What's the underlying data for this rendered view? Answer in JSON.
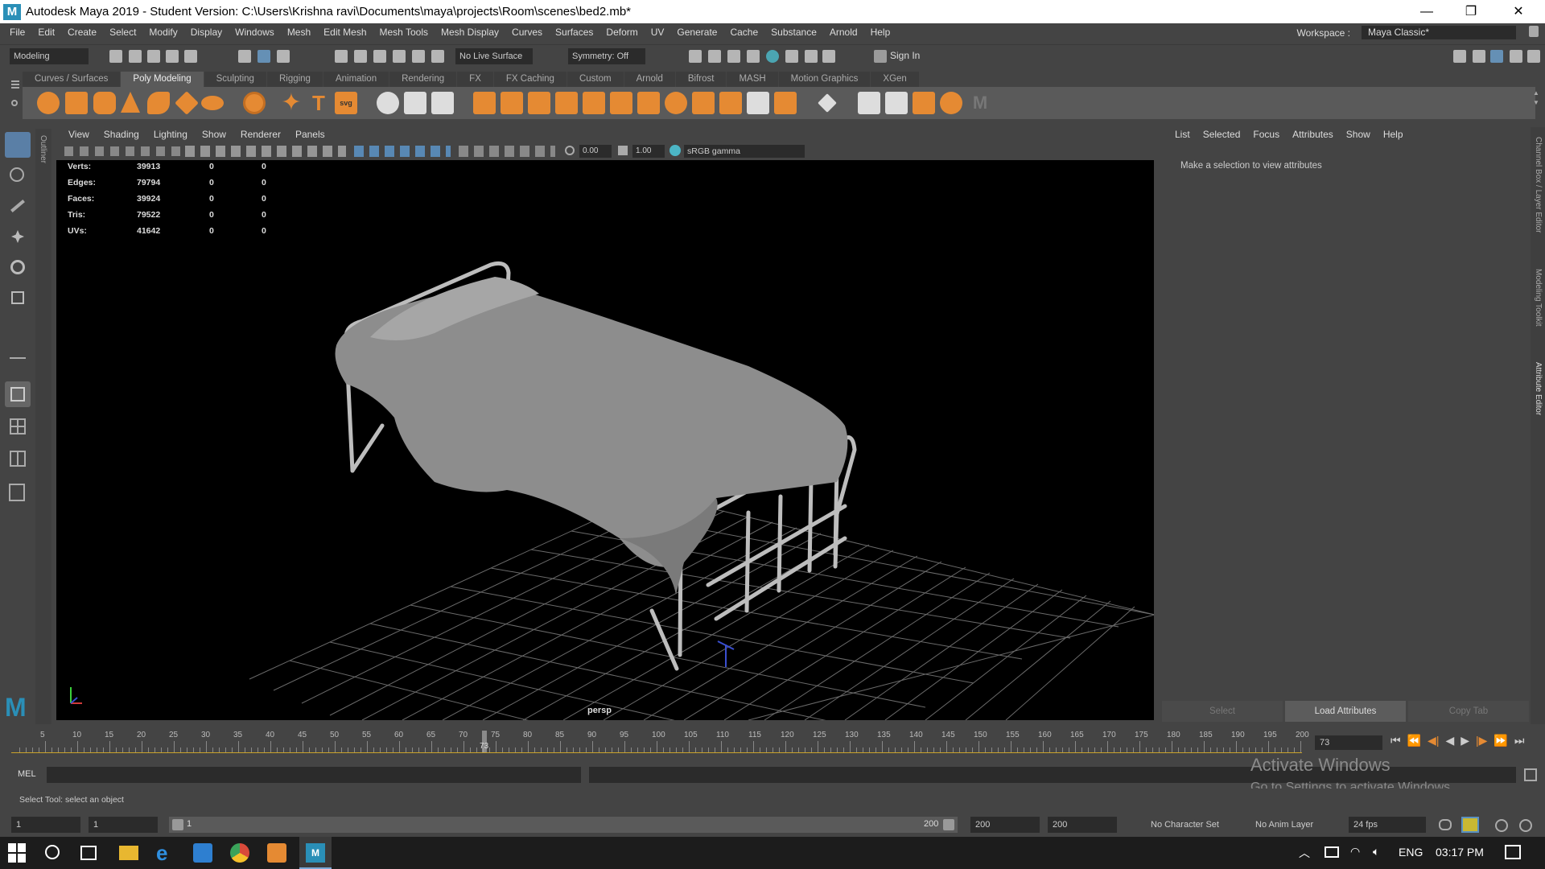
{
  "title_bar": {
    "app_title": "Autodesk Maya 2019 - Student Version: C:\\Users\\Krishna ravi\\Documents\\maya\\projects\\Room\\scenes\\bed2.mb*",
    "logo_letter": "M"
  },
  "menu": [
    "File",
    "Edit",
    "Create",
    "Select",
    "Modify",
    "Display",
    "Windows",
    "Mesh",
    "Edit Mesh",
    "Mesh Tools",
    "Mesh Display",
    "Curves",
    "Surfaces",
    "Deform",
    "UV",
    "Generate",
    "Cache",
    "Substance",
    "Arnold",
    "Help"
  ],
  "workspace": {
    "label": "Workspace :",
    "value": "Maya Classic*"
  },
  "status_line": {
    "mode": "Modeling",
    "live_surface": "No Live Surface",
    "symmetry": "Symmetry: Off",
    "sign_in": "Sign In"
  },
  "shelf_tabs": [
    "Curves / Surfaces",
    "Poly Modeling",
    "Sculpting",
    "Rigging",
    "Animation",
    "Rendering",
    "FX",
    "FX Caching",
    "Custom",
    "Arnold",
    "Bifrost",
    "MASH",
    "Motion Graphics",
    "XGen"
  ],
  "shelf_active": "Poly Modeling",
  "outliner_label": "Outliner",
  "viewport_menu": [
    "View",
    "Shading",
    "Lighting",
    "Show",
    "Renderer",
    "Panels"
  ],
  "viewport_toolbar": {
    "exposure": "0.00",
    "gamma": "1.00",
    "color_space": "sRGB gamma"
  },
  "hud": {
    "rows": [
      {
        "label": "Verts:",
        "v1": "39913",
        "v2": "0",
        "v3": "0"
      },
      {
        "label": "Edges:",
        "v1": "79794",
        "v2": "0",
        "v3": "0"
      },
      {
        "label": "Faces:",
        "v1": "39924",
        "v2": "0",
        "v3": "0"
      },
      {
        "label": "Tris:",
        "v1": "79522",
        "v2": "0",
        "v3": "0"
      },
      {
        "label": "UVs:",
        "v1": "41642",
        "v2": "0",
        "v3": "0"
      }
    ],
    "camera": "persp"
  },
  "attribute_editor": {
    "menu": [
      "List",
      "Selected",
      "Focus",
      "Attributes",
      "Show",
      "Help"
    ],
    "message": "Make a selection to view attributes",
    "buttons": {
      "select": "Select",
      "load": "Load Attributes",
      "copy": "Copy Tab"
    }
  },
  "right_strip": {
    "channel_box": "Channel Box / Layer Editor",
    "modeling_toolkit": "Modeling Toolkit",
    "attribute_editor": "Attribute Editor"
  },
  "timeline": {
    "ticks": [
      "5",
      "10",
      "15",
      "20",
      "25",
      "30",
      "35",
      "40",
      "45",
      "50",
      "55",
      "60",
      "65",
      "70",
      "75",
      "80",
      "85",
      "90",
      "95",
      "100",
      "105",
      "110",
      "115",
      "120",
      "125",
      "130",
      "135",
      "140",
      "145",
      "150",
      "155",
      "160",
      "165",
      "170",
      "175",
      "180",
      "185",
      "190",
      "195",
      "200"
    ],
    "current_frame": "73",
    "current_frame_field": "73"
  },
  "command_line": {
    "lang": "MEL"
  },
  "help_line": {
    "text": "Select Tool: select an object"
  },
  "range": {
    "start": "1",
    "playback_start": "1",
    "slider_start": "1",
    "slider_end": "200",
    "playback_end": "200",
    "end": "200",
    "character_set": "No Character Set",
    "anim_layer": "No Anim Layer",
    "fps": "24 fps"
  },
  "watermark": {
    "line1": "Activate Windows",
    "line2": "Go to Settings to activate Windows."
  },
  "taskbar": {
    "lang": "ENG",
    "time": "03:17 PM"
  }
}
